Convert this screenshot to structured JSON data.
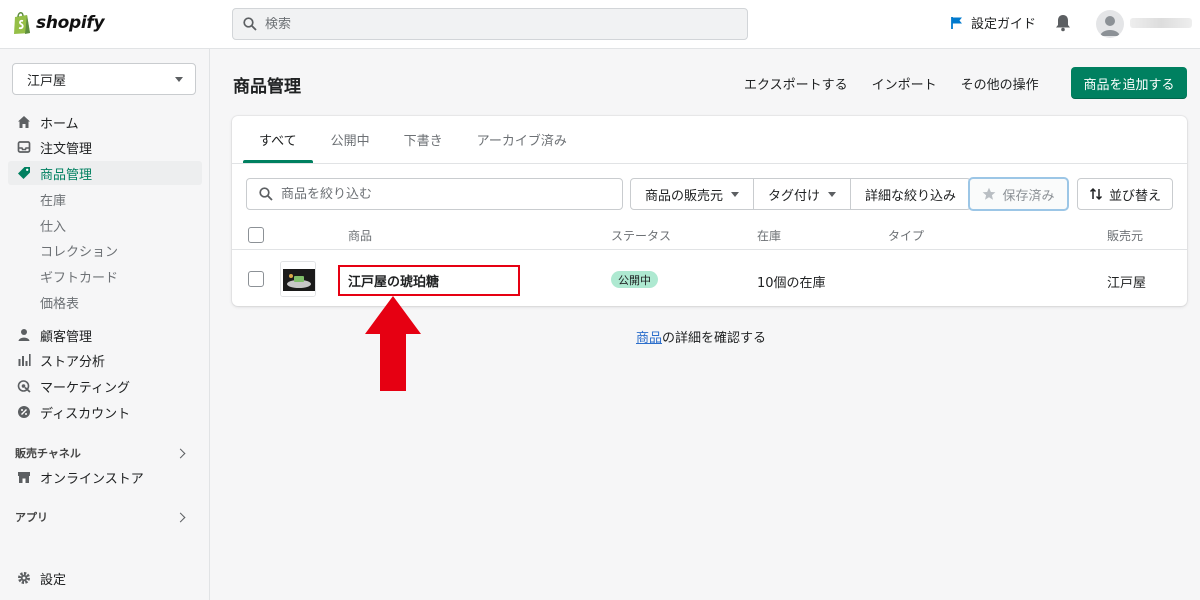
{
  "topbar": {
    "logo_text": "shopify",
    "search_placeholder": "検索",
    "setup_guide": "設定ガイド"
  },
  "sidebar": {
    "store_name": "江戸屋",
    "items": [
      {
        "label": "ホーム",
        "icon": "home-icon"
      },
      {
        "label": "注文管理",
        "icon": "inbox-icon"
      },
      {
        "label": "商品管理",
        "icon": "tag-icon",
        "active": true
      },
      {
        "label": "顧客管理",
        "icon": "person-icon"
      },
      {
        "label": "ストア分析",
        "icon": "bar-chart-icon"
      },
      {
        "label": "マーケティング",
        "icon": "target-icon"
      },
      {
        "label": "ディスカウント",
        "icon": "discount-icon"
      }
    ],
    "subitems": [
      "在庫",
      "仕入",
      "コレクション",
      "ギフトカード",
      "価格表"
    ],
    "sales_channels_label": "販売チャネル",
    "online_store": "オンラインストア",
    "apps_label": "アプリ",
    "settings": "設定"
  },
  "main": {
    "title": "商品管理",
    "export": "エクスポートする",
    "import": "インポート",
    "more_actions": "その他の操作",
    "add_product": "商品を追加する",
    "tabs": [
      "すべて",
      "公開中",
      "下書き",
      "アーカイブ済み"
    ],
    "filter_placeholder": "商品を絞り込む",
    "filters": [
      "商品の販売元",
      "タグ付け",
      "詳細な絞り込み"
    ],
    "saved": "保存済み",
    "sort": "並び替え",
    "columns": {
      "product": "商品",
      "status": "ステータス",
      "inventory": "在庫",
      "type": "タイプ",
      "vendor": "販売元"
    },
    "rows": [
      {
        "name": "江戸屋の琥珀糖",
        "status": "公開中",
        "inventory": "10個の在庫",
        "type": "",
        "vendor": "江戸屋"
      }
    ],
    "footer_link": "商品",
    "footer_text": "の詳細を確認する"
  },
  "colors": {
    "primary": "#008060",
    "highlight_box": "#e60012",
    "arrow": "#e60012",
    "badge_bg": "#aee9d1",
    "link": "#2c6ecb"
  }
}
